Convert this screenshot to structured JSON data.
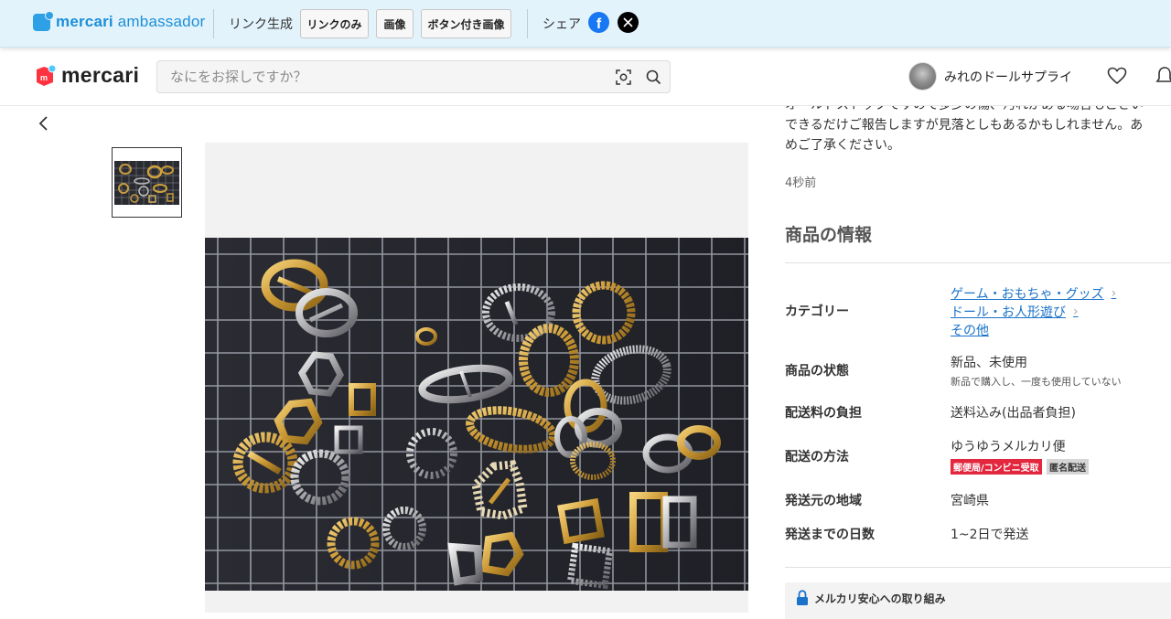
{
  "ambassador": {
    "logo": {
      "brand": "mercari",
      "suffix": "ambassador"
    },
    "link_label": "リンク生成",
    "buttons": [
      "リンクのみ",
      "画像",
      "ボタン付き画像"
    ],
    "share_label": "シェア",
    "share_icons": [
      "facebook-icon",
      "x-icon"
    ]
  },
  "header": {
    "logo": "mercari",
    "search_placeholder": "なにをお探しですか？",
    "search_icons": [
      "camera-scan-icon",
      "search-icon"
    ],
    "username": "みれのドールサプライ",
    "icons": [
      "heart-icon",
      "bell-icon"
    ]
  },
  "description_lines": [
    "オールドストックですので多少の傷、汚れがある場合もござい",
    "できるだけご報告しますが見落としもあるかもしれません。あ",
    "めご了承ください。"
  ],
  "posted_time": "4秒前",
  "info": {
    "title": "商品の情報",
    "category_label": "カテゴリー",
    "categories": [
      "ゲーム・おもちゃ・グッズ",
      "ドール・お人形遊び",
      "その他"
    ],
    "condition_label": "商品の状態",
    "condition_value": "新品、未使用",
    "condition_note": "新品で購入し、一度も使用していない",
    "shipping_fee_label": "配送料の負担",
    "shipping_fee_value": "送料込み(出品者負担)",
    "shipping_method_label": "配送の方法",
    "shipping_method_value": "ゆうゆうメルカリ便",
    "badges": [
      "郵便局/コンビニ受取",
      "匿名配送"
    ],
    "origin_label": "発送元の地域",
    "origin_value": "宮崎県",
    "days_label": "発送までの日数",
    "days_value": "1~2日で発送"
  },
  "safety_title": "メルカリ安心への取り組み",
  "colors": {
    "accent_red": "#e2273e",
    "link_blue": "#1a73c9",
    "ambassador_bg": "#e3f3fc"
  }
}
